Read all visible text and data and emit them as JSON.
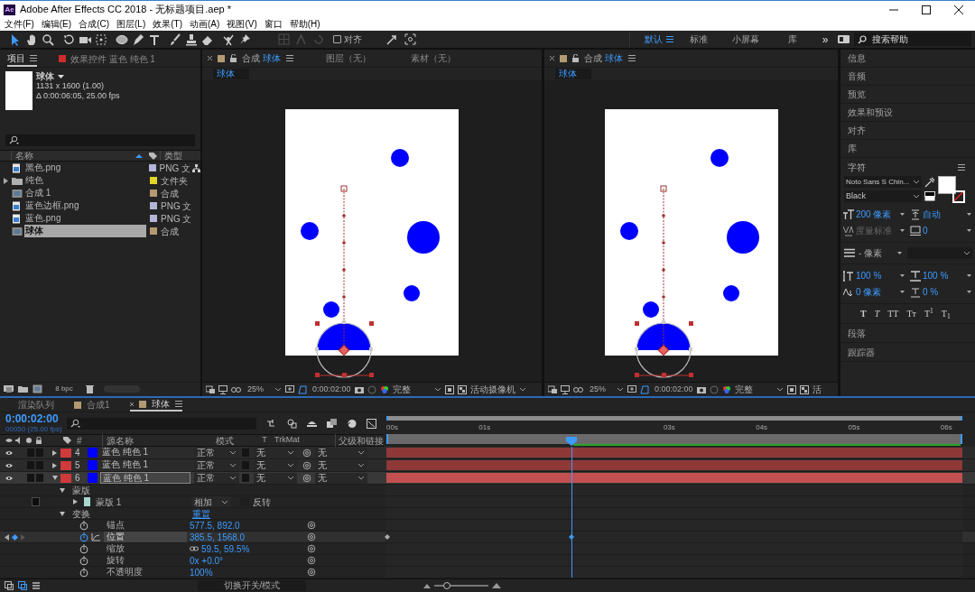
{
  "window": {
    "app_icon": "Ae",
    "title": "Adobe After Effects CC 2018 - 无标题项目.aep *"
  },
  "menu": [
    "文件(F)",
    "编辑(E)",
    "合成(C)",
    "图层(L)",
    "效果(T)",
    "动画(A)",
    "视图(V)",
    "窗口",
    "帮助(H)"
  ],
  "toolbar": {
    "snap": {
      "label": "对齐",
      "checked": false
    },
    "workspaces": [
      {
        "label": "默认",
        "selected": true
      },
      {
        "label": "标准",
        "selected": false
      },
      {
        "label": "小屏幕",
        "selected": false
      },
      {
        "label": "库",
        "selected": false
      }
    ],
    "overflow": "»",
    "search": {
      "placeholder": "搜索帮助"
    }
  },
  "project_panel": {
    "tabs": [
      {
        "label": "项目",
        "selected": true
      },
      {
        "label": "效果控件 蓝色 纯色 1",
        "selected": false
      }
    ],
    "preview": {
      "name": "球体",
      "size": "1131 x 1600 (1.00)",
      "duration": "Δ 0:00:06:05, 25.00 fps"
    },
    "columns": [
      "名称",
      "类型"
    ],
    "items": [
      {
        "kind": "image",
        "name": "黑色.png",
        "color": "#b4b4d8",
        "type": "PNG 文",
        "selected": false
      },
      {
        "kind": "folder",
        "name": "纯色",
        "color": "#e0d52a",
        "type": "文件夹",
        "selected": false
      },
      {
        "kind": "comp",
        "name": "合成 1",
        "color": "#b49a72",
        "type": "合成",
        "selected": false
      },
      {
        "kind": "image",
        "name": "蓝色边框.png",
        "color": "#b4b4d8",
        "type": "PNG 文",
        "selected": false
      },
      {
        "kind": "image",
        "name": "蓝色.png",
        "color": "#b4b4d8",
        "type": "PNG 文",
        "selected": false
      },
      {
        "kind": "comp",
        "name": "球体",
        "color": "#b49a72",
        "type": "合成",
        "selected": true
      }
    ],
    "bit_depth": "8 bpc"
  },
  "viewers": [
    {
      "tab_prefix": "合成",
      "tab_name": "球体",
      "other_tabs": [
        "图层（无）",
        "素材（无）"
      ],
      "breadcrumb": "球体",
      "zoom": "25%",
      "timecode": "0:00:02:00",
      "quality": "完整",
      "camera": "活动摄像机"
    },
    {
      "tab_prefix": "合成",
      "tab_name": "球体",
      "breadcrumb": "球体",
      "zoom": "25%",
      "timecode": "0:00:02:00",
      "quality": "完整",
      "camera": "活"
    }
  ],
  "right_panel": {
    "panels": [
      "信息",
      "音频",
      "预览",
      "效果和预设",
      "对齐",
      "库"
    ],
    "character": {
      "title": "字符",
      "font": "Noto Sans S Chin...",
      "style": "Black",
      "fields": [
        {
          "kind": "size",
          "value": "200 像素",
          "disabled": false
        },
        {
          "kind": "leading",
          "value": "自动",
          "disabled": false
        },
        {
          "kind": "kerning",
          "value": "度量标准",
          "disabled": true
        },
        {
          "kind": "tracking",
          "value": "0",
          "disabled": false
        }
      ],
      "stroke_width": "- 像素",
      "scale_fields": [
        {
          "kind": "vscale",
          "value": "100 %"
        },
        {
          "kind": "hscale",
          "value": "100 %"
        },
        {
          "kind": "baseline",
          "value": "0 像素"
        },
        {
          "kind": "tsume",
          "value": "0 %"
        }
      ],
      "styles": [
        {
          "kind": "bold",
          "label": "T"
        },
        {
          "kind": "italic",
          "label": "T"
        },
        {
          "kind": "caps",
          "label": "TT"
        },
        {
          "kind": "small_caps",
          "label": "Tт"
        },
        {
          "kind": "super",
          "label": "T$^{1}$"
        },
        {
          "kind": "sub",
          "label": "T$_{1}$"
        }
      ]
    },
    "panels_after": [
      "段落",
      "跟踪器"
    ]
  },
  "timeline": {
    "tabs": [
      {
        "label": "渲染队列",
        "swatch": false,
        "selected": false
      },
      {
        "label": "合成1",
        "swatch": true,
        "selected": false
      },
      {
        "label": "球体",
        "swatch": true,
        "selected": true
      }
    ],
    "timecode": "0:00:02:00",
    "frames": "00050 (25.00 fps)",
    "columns": {
      "number": "#",
      "source": "源名称",
      "mode": "模式",
      "t": "T",
      "trkmat": "TrkMat",
      "parent": "父级和链接"
    },
    "ruler": [
      "00s",
      "01s",
      "03s",
      "04s",
      "05s",
      "06s"
    ],
    "layers": [
      {
        "number": "4",
        "name": "蓝色 纯色 1",
        "mode": "正常",
        "trkmat": "无",
        "parent": "无",
        "expanded": false,
        "selected": false
      },
      {
        "number": "5",
        "name": "蓝色 纯色 1",
        "mode": "正常",
        "trkmat": "无",
        "parent": "无",
        "expanded": false,
        "selected": false
      },
      {
        "number": "6",
        "name": "蓝色 纯色 1",
        "mode": "正常",
        "trkmat": "无",
        "parent": "无",
        "expanded": true,
        "selected": true
      }
    ],
    "properties": [
      {
        "kind": "group",
        "label": "蒙版",
        "expanded": true,
        "children": [
          {
            "kind": "mask",
            "label": "蒙版 1",
            "mode": "相加",
            "invert_label": "反转",
            "inverted": false,
            "expanded": false
          }
        ]
      },
      {
        "kind": "group",
        "label": "变换",
        "expanded": true,
        "action": "重置",
        "children": [
          {
            "kind": "property",
            "label": "锚点",
            "value": "577.5, 892.0",
            "selected": false,
            "keyframed": false,
            "linked": false
          },
          {
            "kind": "property",
            "label": "位置",
            "value": "385.5, 1568.0",
            "selected": true,
            "keyframed": true,
            "linked": false
          },
          {
            "kind": "property",
            "label": "缩放",
            "value": "59.5, 59.5%",
            "selected": false,
            "keyframed": false,
            "linked": true
          },
          {
            "kind": "property",
            "label": "旋转",
            "value": "0x +0.0°",
            "selected": false,
            "keyframed": false,
            "linked": false
          },
          {
            "kind": "property",
            "label": "不透明度",
            "value": "100%",
            "selected": false,
            "keyframed": false,
            "linked": false
          }
        ]
      }
    ],
    "zoom": {
      "level": 0.2
    },
    "footer": "切换开关/模式"
  }
}
